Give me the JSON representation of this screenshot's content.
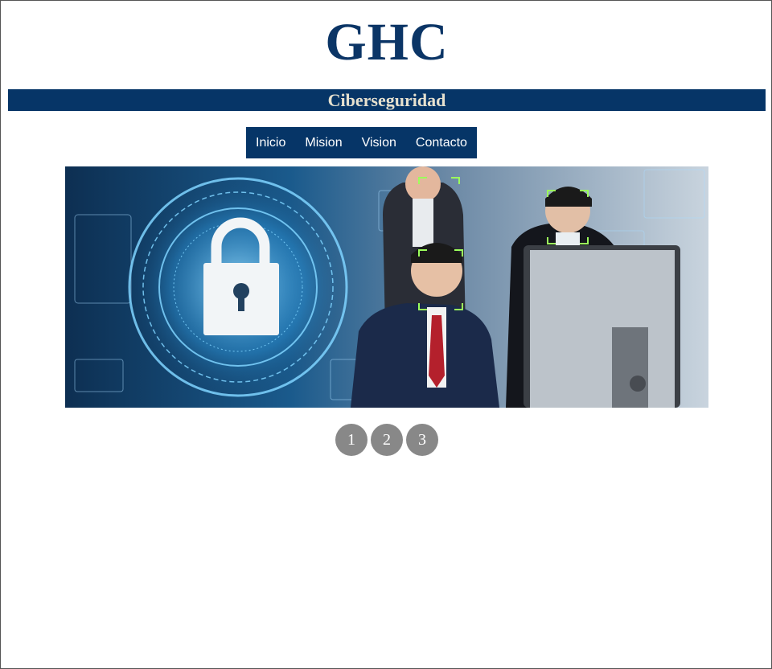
{
  "header": {
    "logo": "GHC",
    "subtitle": "Ciberseguridad"
  },
  "nav": {
    "items": [
      {
        "label": "Inicio"
      },
      {
        "label": "Mision"
      },
      {
        "label": "Vision"
      },
      {
        "label": "Contacto"
      }
    ]
  },
  "carousel": {
    "image_icon": "lock-icon",
    "pages": [
      "1",
      "2",
      "3"
    ]
  },
  "colors": {
    "brand_navy": "#063567",
    "logo_blue": "#0b3566",
    "subtitle_text": "#e6e1cf",
    "dot_gray": "#888888"
  }
}
